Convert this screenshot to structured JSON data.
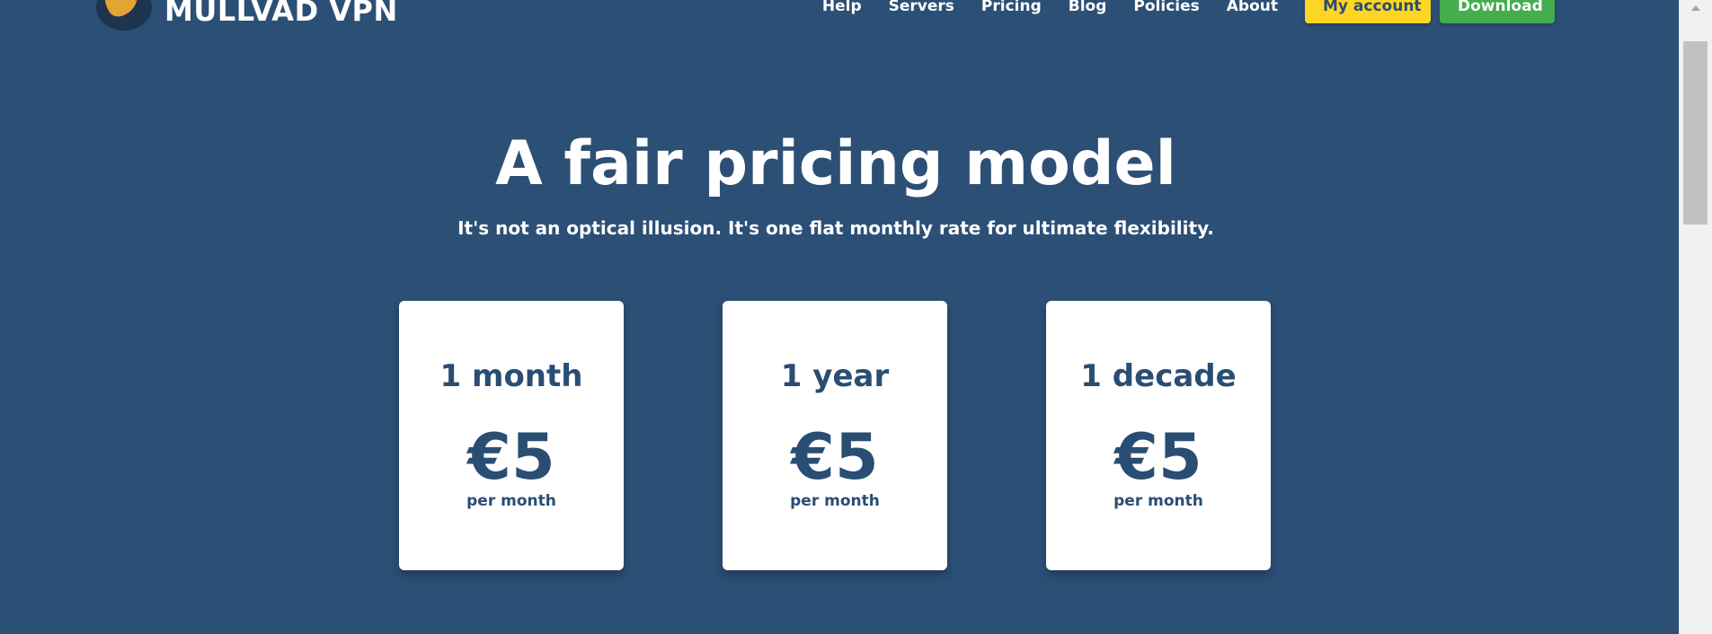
{
  "header": {
    "brand": "MULLVAD VPN",
    "nav": [
      "Help",
      "Servers",
      "Pricing",
      "Blog",
      "Policies",
      "About"
    ],
    "account_label": "My account",
    "download_label": "Download"
  },
  "hero": {
    "title": "A fair pricing model",
    "subtitle": "It's not an optical illusion. It's one flat monthly rate for ultimate flexibility."
  },
  "plans": [
    {
      "period": "1 month",
      "price": "€5",
      "unit": "per month"
    },
    {
      "period": "1 year",
      "price": "€5",
      "unit": "per month"
    },
    {
      "period": "1 decade",
      "price": "€5",
      "unit": "per month"
    }
  ],
  "colors": {
    "background": "#2c4f76",
    "text_dark": "#294d73",
    "account_button": "#ffd524",
    "download_button": "#44ad4d",
    "card": "#ffffff"
  },
  "icons": {
    "logo": "mullvad-mole-icon",
    "scroll_up": "scroll-up-arrow-icon"
  }
}
